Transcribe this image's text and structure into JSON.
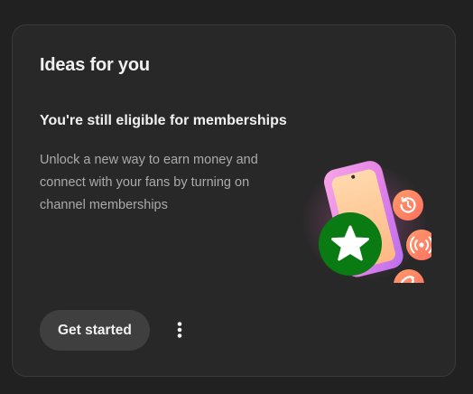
{
  "card": {
    "title": "Ideas for you",
    "idea": {
      "heading": "You're still eligible for memberships",
      "description": "Unlock a new way to earn money and connect with your fans by turning on channel memberships",
      "illustration_icons": [
        "phone",
        "membership-star-badge",
        "history-icon",
        "live-broadcast-icon",
        "shorts-icon"
      ]
    },
    "actions": {
      "primary_label": "Get started",
      "more_icon": "vertical-ellipsis-icon"
    }
  },
  "colors": {
    "background": "#212121",
    "card": "#282828",
    "primary_text": "#f1f1f1",
    "secondary_text": "#aaaaaa",
    "button": "#3f3f3f",
    "badge_green": "#0a7a12"
  }
}
